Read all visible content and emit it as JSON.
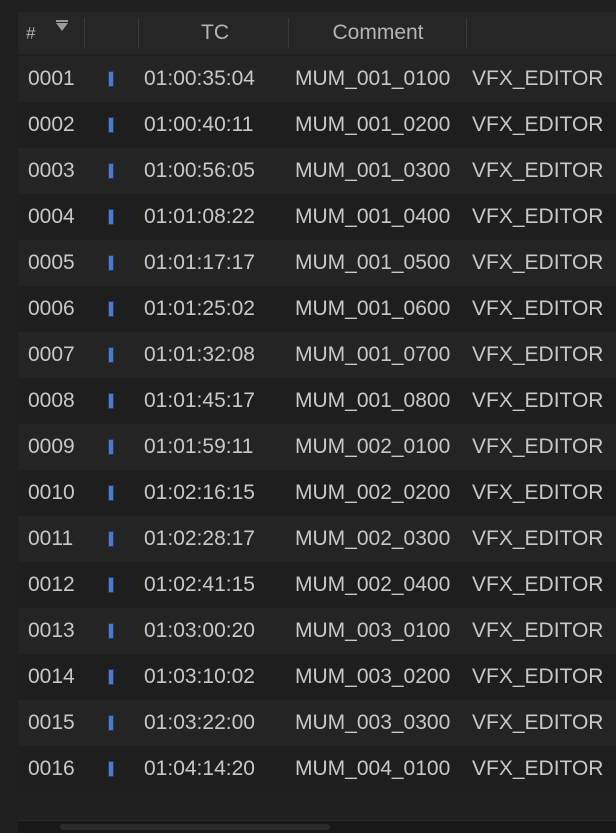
{
  "header": {
    "num_label": "#",
    "tc_label": "TC",
    "comment_label": "Comment"
  },
  "marker_color": "#4f78c8",
  "rows": [
    {
      "num": "0001",
      "tc": "01:00:35:04",
      "clip": "MUM_001_0100",
      "comment": "VFX_EDITOR"
    },
    {
      "num": "0002",
      "tc": "01:00:40:11",
      "clip": "MUM_001_0200",
      "comment": "VFX_EDITOR"
    },
    {
      "num": "0003",
      "tc": "01:00:56:05",
      "clip": "MUM_001_0300",
      "comment": "VFX_EDITOR"
    },
    {
      "num": "0004",
      "tc": "01:01:08:22",
      "clip": "MUM_001_0400",
      "comment": "VFX_EDITOR"
    },
    {
      "num": "0005",
      "tc": "01:01:17:17",
      "clip": "MUM_001_0500",
      "comment": "VFX_EDITOR"
    },
    {
      "num": "0006",
      "tc": "01:01:25:02",
      "clip": "MUM_001_0600",
      "comment": "VFX_EDITOR"
    },
    {
      "num": "0007",
      "tc": "01:01:32:08",
      "clip": "MUM_001_0700",
      "comment": "VFX_EDITOR"
    },
    {
      "num": "0008",
      "tc": "01:01:45:17",
      "clip": "MUM_001_0800",
      "comment": "VFX_EDITOR"
    },
    {
      "num": "0009",
      "tc": "01:01:59:11",
      "clip": "MUM_002_0100",
      "comment": "VFX_EDITOR"
    },
    {
      "num": "0010",
      "tc": "01:02:16:15",
      "clip": "MUM_002_0200",
      "comment": "VFX_EDITOR"
    },
    {
      "num": "0011",
      "tc": "01:02:28:17",
      "clip": "MUM_002_0300",
      "comment": "VFX_EDITOR"
    },
    {
      "num": "0012",
      "tc": "01:02:41:15",
      "clip": "MUM_002_0400",
      "comment": "VFX_EDITOR"
    },
    {
      "num": "0013",
      "tc": "01:03:00:20",
      "clip": "MUM_003_0100",
      "comment": "VFX_EDITOR"
    },
    {
      "num": "0014",
      "tc": "01:03:10:02",
      "clip": "MUM_003_0200",
      "comment": "VFX_EDITOR"
    },
    {
      "num": "0015",
      "tc": "01:03:22:00",
      "clip": "MUM_003_0300",
      "comment": "VFX_EDITOR"
    },
    {
      "num": "0016",
      "tc": "01:04:14:20",
      "clip": "MUM_004_0100",
      "comment": "VFX_EDITOR"
    }
  ]
}
